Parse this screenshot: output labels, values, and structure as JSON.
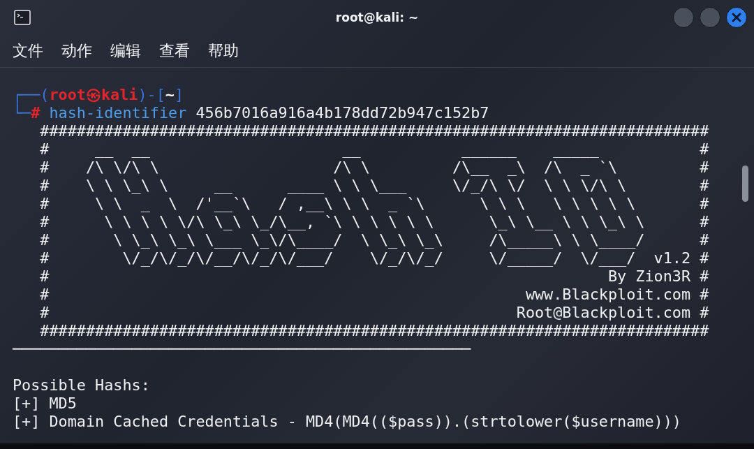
{
  "window": {
    "title": "root@kali: ~"
  },
  "menu": [
    {
      "label": "文件"
    },
    {
      "label": "动作"
    },
    {
      "label": "编辑"
    },
    {
      "label": "查看"
    },
    {
      "label": "帮助"
    }
  ],
  "terminal": {
    "lines": [
      {
        "segments": [
          {
            "kind": "frame",
            "text": "┌──("
          },
          {
            "kind": "user",
            "text": "root㉿kali"
          },
          {
            "kind": "frame",
            "text": ")-["
          },
          {
            "kind": "path",
            "text": "~"
          },
          {
            "kind": "frame",
            "text": "]"
          }
        ]
      },
      {
        "segments": [
          {
            "kind": "frame",
            "text": "└─"
          },
          {
            "kind": "symbol",
            "text": "#"
          },
          {
            "kind": "command",
            "text": " hash-identifier"
          },
          {
            "kind": "plain",
            "text": " 456b7016a916a4b178dd72b947c152b7"
          }
        ]
      },
      {
        "segments": [
          {
            "kind": "plain",
            "text": "   #########################################################################"
          }
        ]
      },
      {
        "segments": [
          {
            "kind": "plain",
            "text": "   #     __  __                     __           ______    _____           #"
          }
        ]
      },
      {
        "segments": [
          {
            "kind": "plain",
            "text": "   #    /\\ \\/\\ \\                   /\\ \\         /\\__  _\\  /\\  _ `\\         #"
          }
        ]
      },
      {
        "segments": [
          {
            "kind": "plain",
            "text": "   #    \\ \\ \\_\\ \\     __      ____ \\ \\ \\___     \\/_/\\ \\/  \\ \\ \\/\\ \\        #"
          }
        ]
      },
      {
        "segments": [
          {
            "kind": "plain",
            "text": "   #     \\ \\  _  \\  /'__`\\   / ,__\\ \\ \\  _ `\\      \\ \\ \\   \\ \\ \\ \\ \\       #"
          }
        ]
      },
      {
        "segments": [
          {
            "kind": "plain",
            "text": "   #      \\ \\ \\ \\ \\/\\ \\_\\ \\_/\\__, `\\ \\ \\ \\ \\ \\      \\_\\ \\__ \\ \\ \\_\\ \\      #"
          }
        ]
      },
      {
        "segments": [
          {
            "kind": "plain",
            "text": "   #       \\ \\_\\ \\_\\ \\___ \\_\\/\\____/  \\ \\_\\ \\_\\     /\\_____\\ \\ \\____/      #"
          }
        ]
      },
      {
        "segments": [
          {
            "kind": "plain",
            "text": "   #        \\/_/\\/_/\\/__/\\/_/\\/___/    \\/_/\\/_/     \\/_____/  \\/___/  v1.2 #"
          }
        ]
      },
      {
        "segments": [
          {
            "kind": "plain",
            "text": "   #                                                             By Zion3R #"
          }
        ]
      },
      {
        "segments": [
          {
            "kind": "plain",
            "text": "   #                                                    www.Blackploit.com #"
          }
        ]
      },
      {
        "segments": [
          {
            "kind": "plain",
            "text": "   #                                                   Root@Blackploit.com #"
          }
        ]
      },
      {
        "segments": [
          {
            "kind": "plain",
            "text": "   #########################################################################"
          }
        ]
      },
      {
        "segments": [
          {
            "kind": "plain",
            "text": "──────────────────────────────────────────────────"
          }
        ]
      },
      {
        "kind": "blank"
      },
      {
        "segments": [
          {
            "kind": "plain",
            "text": "Possible Hashs:"
          }
        ]
      },
      {
        "segments": [
          {
            "kind": "plain",
            "text": "[+] MD5"
          }
        ]
      },
      {
        "segments": [
          {
            "kind": "plain",
            "text": "[+] Domain Cached Credentials - MD4(MD4(($pass)).(strtolower($username)))"
          }
        ]
      }
    ]
  }
}
